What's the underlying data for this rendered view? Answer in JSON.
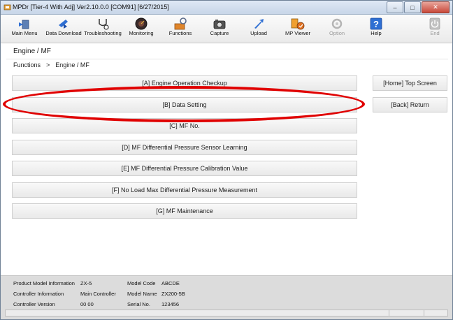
{
  "window": {
    "title": "MPDr [Tier-4 With Adj] Ver2.10.0.0 [COM91] [6/27/2015]"
  },
  "toolbar": [
    {
      "label": "Main Menu",
      "icon": "main-menu-icon",
      "disabled": false
    },
    {
      "label": "Data Download",
      "icon": "data-download-icon",
      "disabled": false
    },
    {
      "label": "Troubleshooting",
      "icon": "troubleshooting-icon",
      "disabled": false
    },
    {
      "label": "Monitoring",
      "icon": "monitoring-icon",
      "disabled": false
    },
    {
      "label": "Functions",
      "icon": "functions-icon",
      "disabled": false
    },
    {
      "label": "Capture",
      "icon": "capture-icon",
      "disabled": false
    },
    {
      "label": "Upload",
      "icon": "upload-icon",
      "disabled": false
    },
    {
      "label": "MP Viewer",
      "icon": "mp-viewer-icon",
      "disabled": false
    },
    {
      "label": "Option",
      "icon": "option-icon",
      "disabled": true
    },
    {
      "label": "Help",
      "icon": "help-icon",
      "disabled": false
    },
    {
      "label": "End",
      "icon": "end-icon",
      "disabled": true
    }
  ],
  "page": {
    "title": "Engine / MF",
    "breadcrumb": [
      "Functions",
      ">",
      "Engine / MF"
    ]
  },
  "menu": [
    "[A] Engine Operation Checkup",
    "[B] Data Setting",
    "[C] MF No.",
    "[D] MF Differential Pressure Sensor Learning",
    "[E] MF Differential Pressure Calibration Value",
    "[F] No Load Max Differential Pressure Measurement",
    "[G] MF Maintenance"
  ],
  "side": {
    "home": "[Home] Top Screen",
    "back": "[Back] Return"
  },
  "info": {
    "product_model_label": "Product Model Information",
    "product_model_value": "ZX-5",
    "controller_info_label": "Controller Information",
    "controller_info_value": "Main Controller",
    "controller_version_label": "Controller Version",
    "controller_version_value": "00 00",
    "model_code_label": "Model Code",
    "model_code_value": "ABCDE",
    "model_name_label": "Model Name",
    "model_name_value": "ZX200-5B",
    "serial_label": "Serial No.",
    "serial_value": "123456"
  },
  "colors": {
    "highlight": "#e00000"
  }
}
